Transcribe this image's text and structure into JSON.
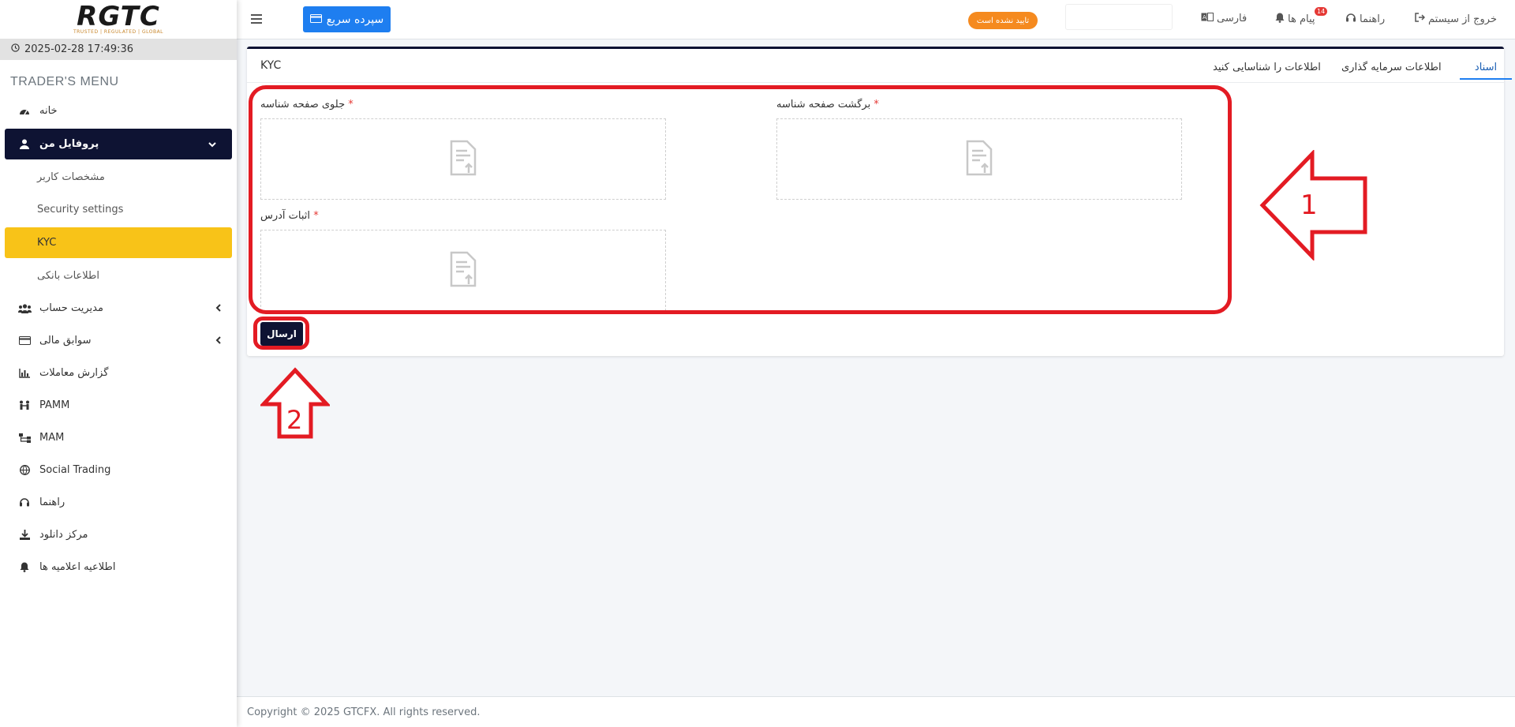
{
  "brand": {
    "logo_text": "RGTC",
    "tagline": "TRUSTED | REGULATED | GLOBAL"
  },
  "sidebar": {
    "datetime": "2025-02-28 17:49:36",
    "menu_title": "TRADER'S MENU",
    "items": {
      "home": "خانه",
      "profile": "پروفایل من",
      "user_details": "مشخصات کاربر",
      "security": "Security settings",
      "kyc": "KYC",
      "bank_info": "اطلاعات بانکی",
      "account_mgmt": "مدیریت حساب",
      "financial_history": "سوابق مالی",
      "trade_report": "گزارش معاملات",
      "pamm": "PAMM",
      "mam": "MAM",
      "social_trading": "Social Trading",
      "guide": "راهنما",
      "download_center": "مرکز دانلود",
      "announcements": "اطلاعیه اعلامیه ها"
    }
  },
  "header": {
    "quick_deposit": "سپرده سریع",
    "unverified": "تایید نشده است",
    "language": "فارسی",
    "messages": "پیام ها",
    "messages_count": "14",
    "guide": "راهنما",
    "logout": "خروج از سیستم"
  },
  "card": {
    "title": "KYC",
    "tabs": {
      "documents": "اسناد",
      "investment_info": "اطلاعات سرمایه گذاری",
      "identify_info": "اطلاعات را شناسایی کنید"
    },
    "fields": {
      "front_id": "جلوی صفحه شناسه",
      "back_id": "برگشت صفحه شناسه",
      "address_proof": "اثبات آدرس",
      "required_mark": "*"
    },
    "submit": "ارسال"
  },
  "annotations": {
    "label_1": "1",
    "label_2": "2",
    "color": "#e31b23"
  },
  "footer": {
    "copyright": "Copyright © 2025 GTCFX. All rights reserved."
  },
  "colors": {
    "navy": "#0e1333",
    "active_yellow": "#f8c318",
    "primary_blue": "#1e7ef0",
    "badge_orange": "#f58a1f"
  }
}
